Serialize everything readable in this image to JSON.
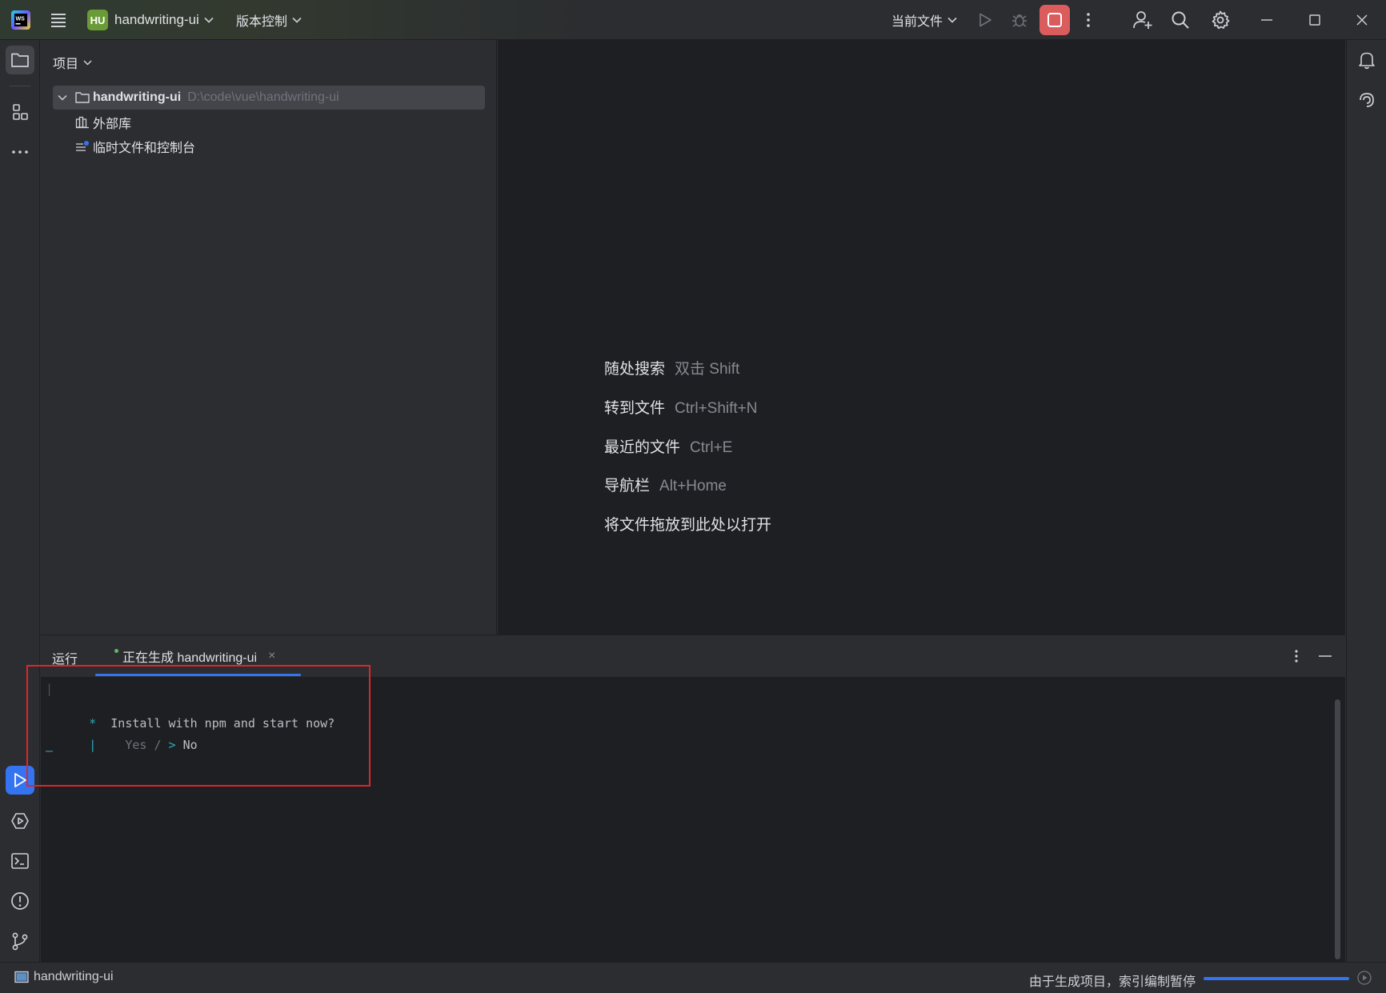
{
  "titlebar": {
    "app_logo": "webstorm-logo",
    "menu_icon": "hamburger-menu-icon",
    "project_badge": "HU",
    "project_name": "handwriting-ui",
    "vcs_label": "版本控制",
    "run_config_label": "当前文件",
    "icons": [
      "run-icon",
      "debug-icon",
      "stop-icon",
      "more-vertical-icon",
      "add-user-icon",
      "search-icon",
      "settings-gear-icon",
      "minimize-icon",
      "maximize-icon",
      "close-icon"
    ],
    "stop_color": "#db5c5c"
  },
  "left_strip": {
    "top_icons": [
      "folder-icon",
      "structure-icon",
      "more-horizontal-icon"
    ],
    "bottom_icons": [
      "run-tool-icon",
      "services-icon",
      "terminal-icon",
      "problems-icon",
      "git-icon"
    ]
  },
  "right_strip": {
    "icons": [
      "notifications-bell-icon",
      "ai-assistant-icon"
    ]
  },
  "project_panel": {
    "title": "项目",
    "tree": {
      "root_name": "handwriting-ui",
      "root_path": "D:\\code\\vue\\handwriting-ui",
      "children": [
        {
          "label": "外部库",
          "icon": "library-icon"
        },
        {
          "label": "临时文件和控制台",
          "icon": "scratches-icon"
        }
      ]
    }
  },
  "editor_hints": [
    {
      "action": "随处搜索",
      "shortcut": "双击 Shift"
    },
    {
      "action": "转到文件",
      "shortcut": "Ctrl+Shift+N"
    },
    {
      "action": "最近的文件",
      "shortcut": "Ctrl+E"
    },
    {
      "action": "导航栏",
      "shortcut": "Alt+Home"
    },
    {
      "action": "将文件拖放到此处以打开",
      "shortcut": ""
    }
  ],
  "run_panel": {
    "title": "运行",
    "tab_label": "正在生成 handwriting-ui",
    "tab_close": "×",
    "console": {
      "line1_marker": "|",
      "line2_marker": "*",
      "line2_text": "Install with npm and start now?",
      "line3_marker": "|",
      "line3_yes": "Yes",
      "line3_sep": "/",
      "line3_arrow": ">",
      "line3_no": "No",
      "line4_marker": "—"
    },
    "highlight_color": "#e0242b",
    "accent_color": "#3574f0"
  },
  "statusbar": {
    "project": "handwriting-ui",
    "message": "由于生成项目，索引编制暂停",
    "progress": 1.0
  }
}
